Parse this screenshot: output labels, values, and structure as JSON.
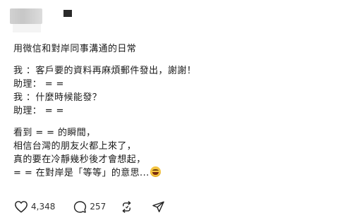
{
  "post": {
    "lines": [
      "用微信和對岸同事溝通的日常",
      "",
      "我 ：客戶要的資料再麻煩郵件發出，謝謝！",
      "助理： = =",
      "我 ：什麼時候能發？",
      "助理： = =",
      "",
      "看到 = = 的瞬間，",
      "相信台灣的朋友火都上來了，",
      "真的要在冷靜幾秒後才會想起，",
      "= = 在對岸是「等等」的意思..."
    ],
    "emoji": "grinning-sweat-emoji"
  },
  "actions": {
    "likes": "4,348",
    "comments": "257"
  },
  "icons": {
    "like": "heart-icon",
    "comment": "comment-icon",
    "repost": "repost-icon",
    "share": "send-icon"
  }
}
